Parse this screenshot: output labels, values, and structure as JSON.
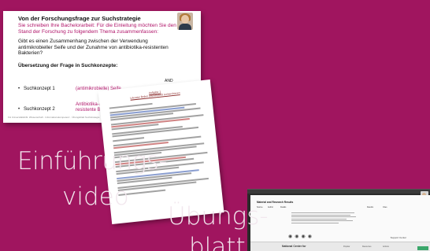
{
  "slide": {
    "title": "Von der Forschungsfrage zur Suchstrategie",
    "subtitle": "Sie schreiben Ihre Bachelorarbeit: Für die Einleitung möchten Sie den Stand der Forschung zu folgendem Thema zusammenfassen:",
    "question": "Gibt es einen Zusammenhang zwischen der Verwendung antimikrobieller Seife und der Zunahme von antibiotika-resistenten Bakterien?",
    "translation_heading": "Übersetzung der Frage in Suchkonzepte:",
    "concept1_label": "Suchkonzept 1",
    "concept1_value": "(antimikrobielle) Seife",
    "concept2_label": "Suchkonzept 2",
    "concept2_value": "Antibiotika-Resistenz, Antibiotika resistente Bakterien",
    "operator": "AND",
    "footer": "FH Universitätsbibl. Wissenschaft · Informationskompetenz · Übungsblatt Suchstrategie"
  },
  "worksheet": {
    "heading_line1": "Aufgabe 1",
    "heading_line2": "Literatur finden und effizient recherchieren"
  },
  "screenshot": {
    "page_title": "Material and Research Results",
    "columns": [
      "Source",
      "Author",
      "Details",
      "Results",
      "Cites"
    ],
    "footer_org": "National Center for",
    "footer_links": [
      "Popular",
      "Resources",
      "Actions"
    ],
    "support": "Support Center"
  },
  "labels": {
    "line1": "Einführungs-",
    "line2": "video",
    "line3": "Übungs-",
    "line4": "blatt"
  },
  "colors": {
    "background": "#a0155f",
    "accent": "#b0156a"
  }
}
